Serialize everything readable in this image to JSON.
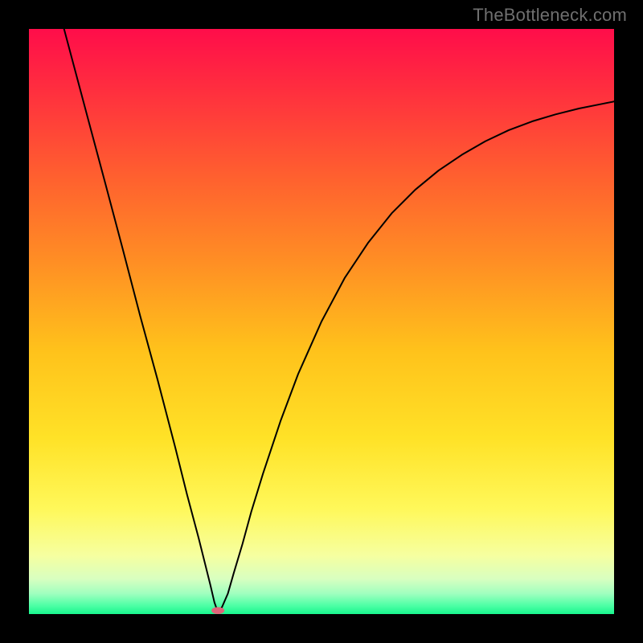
{
  "watermark": "TheBottleneck.com",
  "chart_data": {
    "type": "line",
    "title": "",
    "xlabel": "",
    "ylabel": "",
    "xlim": [
      0,
      100
    ],
    "ylim": [
      0,
      100
    ],
    "background_gradient_stops": [
      {
        "offset": 0.0,
        "color": "#ff0d4a"
      },
      {
        "offset": 0.1,
        "color": "#ff2d3f"
      },
      {
        "offset": 0.25,
        "color": "#ff5f2f"
      },
      {
        "offset": 0.4,
        "color": "#ff8f24"
      },
      {
        "offset": 0.55,
        "color": "#ffc21b"
      },
      {
        "offset": 0.7,
        "color": "#ffe227"
      },
      {
        "offset": 0.82,
        "color": "#fff85a"
      },
      {
        "offset": 0.9,
        "color": "#f6ffa0"
      },
      {
        "offset": 0.94,
        "color": "#d8ffc0"
      },
      {
        "offset": 0.965,
        "color": "#a0ffbf"
      },
      {
        "offset": 0.985,
        "color": "#4fffa6"
      },
      {
        "offset": 1.0,
        "color": "#19f68e"
      }
    ],
    "curve": [
      {
        "x": 6.0,
        "y": 100.0
      },
      {
        "x": 8.0,
        "y": 92.5
      },
      {
        "x": 10.0,
        "y": 85.0
      },
      {
        "x": 13.0,
        "y": 73.8
      },
      {
        "x": 16.0,
        "y": 62.5
      },
      {
        "x": 19.0,
        "y": 51.0
      },
      {
        "x": 22.0,
        "y": 40.0
      },
      {
        "x": 25.0,
        "y": 28.5
      },
      {
        "x": 27.0,
        "y": 20.5
      },
      {
        "x": 29.0,
        "y": 13.0
      },
      {
        "x": 30.0,
        "y": 9.0
      },
      {
        "x": 31.0,
        "y": 5.0
      },
      {
        "x": 31.7,
        "y": 2.0
      },
      {
        "x": 32.3,
        "y": 0.3
      },
      {
        "x": 33.0,
        "y": 1.2
      },
      {
        "x": 34.0,
        "y": 3.5
      },
      {
        "x": 35.0,
        "y": 7.0
      },
      {
        "x": 36.5,
        "y": 12.0
      },
      {
        "x": 38.0,
        "y": 17.5
      },
      {
        "x": 40.0,
        "y": 24.0
      },
      {
        "x": 43.0,
        "y": 33.0
      },
      {
        "x": 46.0,
        "y": 41.0
      },
      {
        "x": 50.0,
        "y": 50.0
      },
      {
        "x": 54.0,
        "y": 57.5
      },
      {
        "x": 58.0,
        "y": 63.5
      },
      {
        "x": 62.0,
        "y": 68.5
      },
      {
        "x": 66.0,
        "y": 72.5
      },
      {
        "x": 70.0,
        "y": 75.8
      },
      {
        "x": 74.0,
        "y": 78.5
      },
      {
        "x": 78.0,
        "y": 80.8
      },
      {
        "x": 82.0,
        "y": 82.7
      },
      {
        "x": 86.0,
        "y": 84.2
      },
      {
        "x": 90.0,
        "y": 85.4
      },
      {
        "x": 94.0,
        "y": 86.4
      },
      {
        "x": 98.0,
        "y": 87.2
      },
      {
        "x": 100.0,
        "y": 87.6
      }
    ],
    "marker": {
      "x": 32.3,
      "y": 0.6,
      "rx": 1.1,
      "ry": 0.6,
      "color": "#e0657a"
    },
    "curve_color": "#000000",
    "curve_width": 2.0
  }
}
